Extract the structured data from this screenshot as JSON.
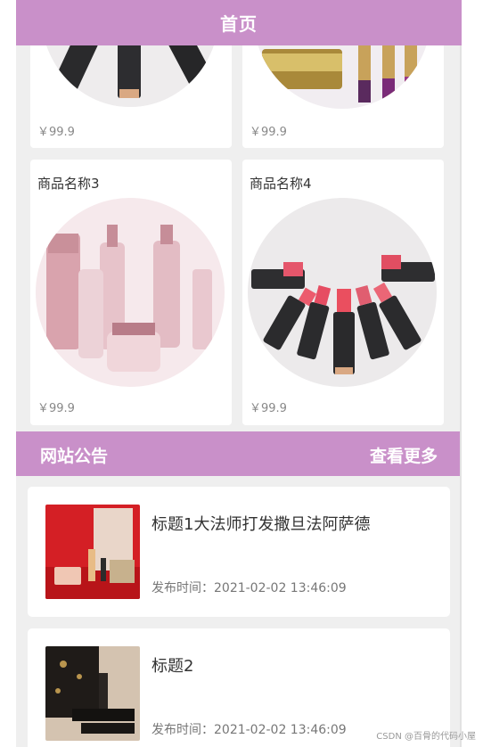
{
  "header": {
    "title": "首页"
  },
  "products_top": [
    {
      "price": "￥99.9"
    },
    {
      "price": "￥99.9"
    }
  ],
  "products": [
    {
      "name": "商品名称3",
      "price": "￥99.9"
    },
    {
      "name": "商品名称4",
      "price": "￥99.9"
    }
  ],
  "notice_section": {
    "title": "网站公告",
    "more_label": "查看更多"
  },
  "notices": [
    {
      "title": "标题1大法师打发撒旦法阿萨德",
      "time": "发布时间：2021-02-02 13:46:09"
    },
    {
      "title": "标题2",
      "time": "发布时间：2021-02-02 13:46:09"
    }
  ],
  "watermark": "CSDN @百骨的代码小屋",
  "colors": {
    "accent": "#c990c9",
    "background": "#efefef"
  }
}
